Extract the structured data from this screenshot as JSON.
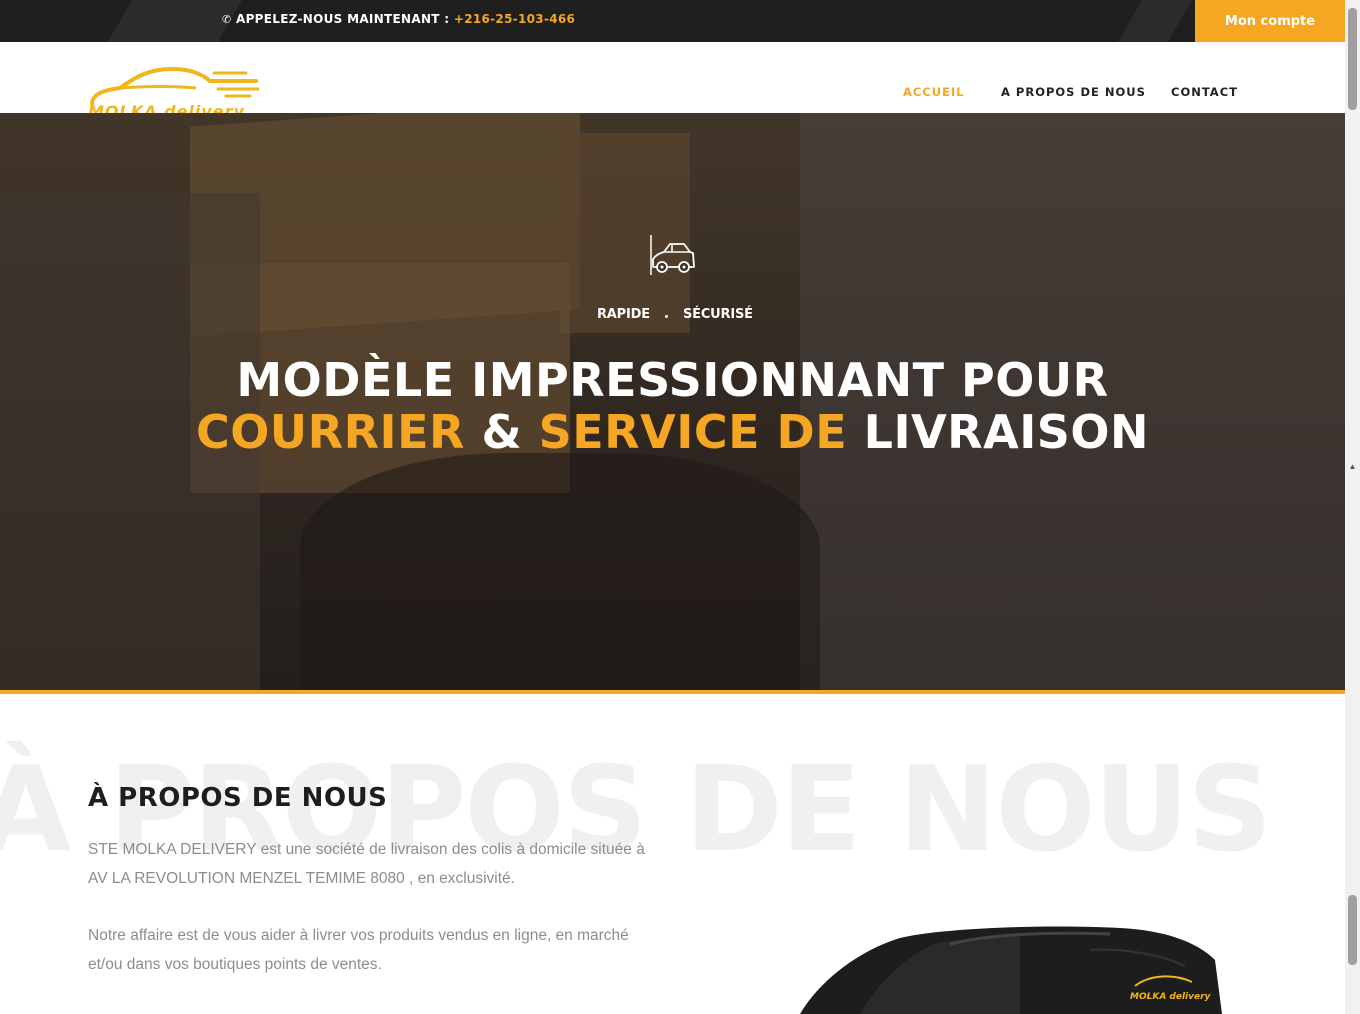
{
  "topbar": {
    "phone_label": "APPELEZ-NOUS MAINTENANT :",
    "phone_number": "+216-25-103-466",
    "phone_icon": "phone-icon",
    "account_button": "Mon compte"
  },
  "header": {
    "logo_text": "MOLKA delivery",
    "nav": [
      "ACCUEIL",
      "A PROPOS DE NOUS",
      "CONTACT"
    ],
    "active_nav": "ACCUEIL"
  },
  "hero": {
    "icon": "delivery-car-icon",
    "tags": [
      "RAPIDE",
      "SÉCURISÉ"
    ],
    "title_line1": "MODÈLE IMPRESSIONNANT POUR",
    "title_line2_part1": "COURRIER",
    "title_line2_part2": " & ",
    "title_line2_part3": "SERVICE DE",
    "title_line2_part4": " LIVRAISON"
  },
  "about": {
    "watermark": "À PROPOS DE NOUS",
    "title": "À PROPOS DE NOUS",
    "paragraph1": "STE MOLKA DELIVERY est une société de livraison des colis à domicile située à AV LA REVOLUTION MENZEL TEMIME 8080 , en exclusivité.",
    "paragraph2": "Notre affaire est de vous aider à livrer vos produits vendus en ligne, en marché et/ou dans vos boutiques points de ventes.",
    "van_logo_text": "MOLKA delivery"
  },
  "colors": {
    "accent": "#f5a623",
    "topbar": "#1f1f1f",
    "text_dark": "#1e1e1e",
    "text_muted": "#8d8d8d"
  }
}
